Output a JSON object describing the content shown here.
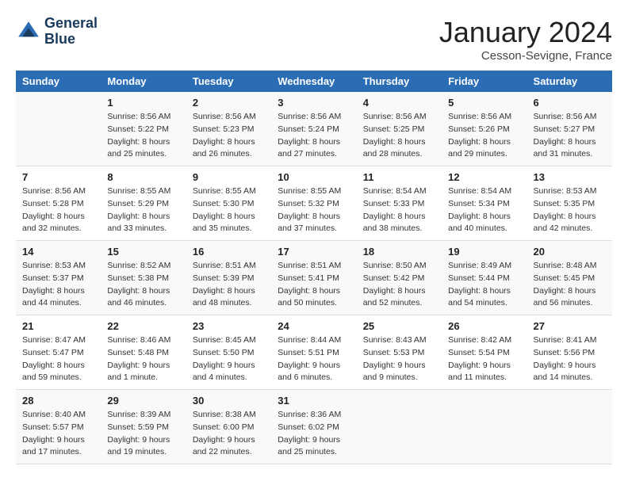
{
  "header": {
    "logo_line1": "General",
    "logo_line2": "Blue",
    "title": "January 2024",
    "subtitle": "Cesson-Sevigne, France"
  },
  "weekdays": [
    "Sunday",
    "Monday",
    "Tuesday",
    "Wednesday",
    "Thursday",
    "Friday",
    "Saturday"
  ],
  "weeks": [
    [
      {
        "day": "",
        "sunrise": "",
        "sunset": "",
        "daylight": ""
      },
      {
        "day": "1",
        "sunrise": "Sunrise: 8:56 AM",
        "sunset": "Sunset: 5:22 PM",
        "daylight": "Daylight: 8 hours and 25 minutes."
      },
      {
        "day": "2",
        "sunrise": "Sunrise: 8:56 AM",
        "sunset": "Sunset: 5:23 PM",
        "daylight": "Daylight: 8 hours and 26 minutes."
      },
      {
        "day": "3",
        "sunrise": "Sunrise: 8:56 AM",
        "sunset": "Sunset: 5:24 PM",
        "daylight": "Daylight: 8 hours and 27 minutes."
      },
      {
        "day": "4",
        "sunrise": "Sunrise: 8:56 AM",
        "sunset": "Sunset: 5:25 PM",
        "daylight": "Daylight: 8 hours and 28 minutes."
      },
      {
        "day": "5",
        "sunrise": "Sunrise: 8:56 AM",
        "sunset": "Sunset: 5:26 PM",
        "daylight": "Daylight: 8 hours and 29 minutes."
      },
      {
        "day": "6",
        "sunrise": "Sunrise: 8:56 AM",
        "sunset": "Sunset: 5:27 PM",
        "daylight": "Daylight: 8 hours and 31 minutes."
      }
    ],
    [
      {
        "day": "7",
        "sunrise": "Sunrise: 8:56 AM",
        "sunset": "Sunset: 5:28 PM",
        "daylight": "Daylight: 8 hours and 32 minutes."
      },
      {
        "day": "8",
        "sunrise": "Sunrise: 8:55 AM",
        "sunset": "Sunset: 5:29 PM",
        "daylight": "Daylight: 8 hours and 33 minutes."
      },
      {
        "day": "9",
        "sunrise": "Sunrise: 8:55 AM",
        "sunset": "Sunset: 5:30 PM",
        "daylight": "Daylight: 8 hours and 35 minutes."
      },
      {
        "day": "10",
        "sunrise": "Sunrise: 8:55 AM",
        "sunset": "Sunset: 5:32 PM",
        "daylight": "Daylight: 8 hours and 37 minutes."
      },
      {
        "day": "11",
        "sunrise": "Sunrise: 8:54 AM",
        "sunset": "Sunset: 5:33 PM",
        "daylight": "Daylight: 8 hours and 38 minutes."
      },
      {
        "day": "12",
        "sunrise": "Sunrise: 8:54 AM",
        "sunset": "Sunset: 5:34 PM",
        "daylight": "Daylight: 8 hours and 40 minutes."
      },
      {
        "day": "13",
        "sunrise": "Sunrise: 8:53 AM",
        "sunset": "Sunset: 5:35 PM",
        "daylight": "Daylight: 8 hours and 42 minutes."
      }
    ],
    [
      {
        "day": "14",
        "sunrise": "Sunrise: 8:53 AM",
        "sunset": "Sunset: 5:37 PM",
        "daylight": "Daylight: 8 hours and 44 minutes."
      },
      {
        "day": "15",
        "sunrise": "Sunrise: 8:52 AM",
        "sunset": "Sunset: 5:38 PM",
        "daylight": "Daylight: 8 hours and 46 minutes."
      },
      {
        "day": "16",
        "sunrise": "Sunrise: 8:51 AM",
        "sunset": "Sunset: 5:39 PM",
        "daylight": "Daylight: 8 hours and 48 minutes."
      },
      {
        "day": "17",
        "sunrise": "Sunrise: 8:51 AM",
        "sunset": "Sunset: 5:41 PM",
        "daylight": "Daylight: 8 hours and 50 minutes."
      },
      {
        "day": "18",
        "sunrise": "Sunrise: 8:50 AM",
        "sunset": "Sunset: 5:42 PM",
        "daylight": "Daylight: 8 hours and 52 minutes."
      },
      {
        "day": "19",
        "sunrise": "Sunrise: 8:49 AM",
        "sunset": "Sunset: 5:44 PM",
        "daylight": "Daylight: 8 hours and 54 minutes."
      },
      {
        "day": "20",
        "sunrise": "Sunrise: 8:48 AM",
        "sunset": "Sunset: 5:45 PM",
        "daylight": "Daylight: 8 hours and 56 minutes."
      }
    ],
    [
      {
        "day": "21",
        "sunrise": "Sunrise: 8:47 AM",
        "sunset": "Sunset: 5:47 PM",
        "daylight": "Daylight: 8 hours and 59 minutes."
      },
      {
        "day": "22",
        "sunrise": "Sunrise: 8:46 AM",
        "sunset": "Sunset: 5:48 PM",
        "daylight": "Daylight: 9 hours and 1 minute."
      },
      {
        "day": "23",
        "sunrise": "Sunrise: 8:45 AM",
        "sunset": "Sunset: 5:50 PM",
        "daylight": "Daylight: 9 hours and 4 minutes."
      },
      {
        "day": "24",
        "sunrise": "Sunrise: 8:44 AM",
        "sunset": "Sunset: 5:51 PM",
        "daylight": "Daylight: 9 hours and 6 minutes."
      },
      {
        "day": "25",
        "sunrise": "Sunrise: 8:43 AM",
        "sunset": "Sunset: 5:53 PM",
        "daylight": "Daylight: 9 hours and 9 minutes."
      },
      {
        "day": "26",
        "sunrise": "Sunrise: 8:42 AM",
        "sunset": "Sunset: 5:54 PM",
        "daylight": "Daylight: 9 hours and 11 minutes."
      },
      {
        "day": "27",
        "sunrise": "Sunrise: 8:41 AM",
        "sunset": "Sunset: 5:56 PM",
        "daylight": "Daylight: 9 hours and 14 minutes."
      }
    ],
    [
      {
        "day": "28",
        "sunrise": "Sunrise: 8:40 AM",
        "sunset": "Sunset: 5:57 PM",
        "daylight": "Daylight: 9 hours and 17 minutes."
      },
      {
        "day": "29",
        "sunrise": "Sunrise: 8:39 AM",
        "sunset": "Sunset: 5:59 PM",
        "daylight": "Daylight: 9 hours and 19 minutes."
      },
      {
        "day": "30",
        "sunrise": "Sunrise: 8:38 AM",
        "sunset": "Sunset: 6:00 PM",
        "daylight": "Daylight: 9 hours and 22 minutes."
      },
      {
        "day": "31",
        "sunrise": "Sunrise: 8:36 AM",
        "sunset": "Sunset: 6:02 PM",
        "daylight": "Daylight: 9 hours and 25 minutes."
      },
      {
        "day": "",
        "sunrise": "",
        "sunset": "",
        "daylight": ""
      },
      {
        "day": "",
        "sunrise": "",
        "sunset": "",
        "daylight": ""
      },
      {
        "day": "",
        "sunrise": "",
        "sunset": "",
        "daylight": ""
      }
    ]
  ]
}
